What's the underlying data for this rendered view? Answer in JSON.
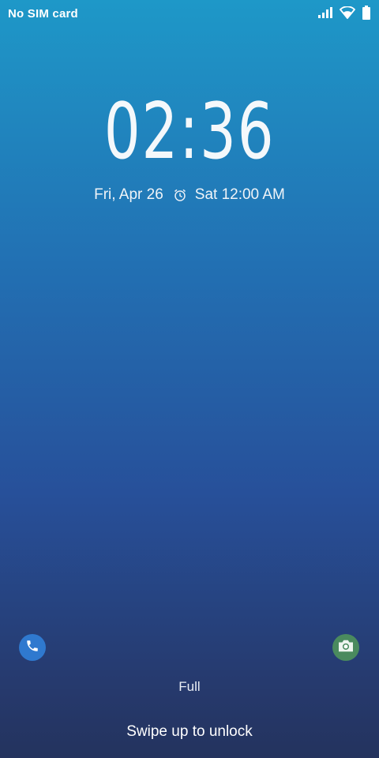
{
  "status_bar": {
    "carrier": "No SIM card",
    "icons": [
      "signal-icon",
      "wifi-icon",
      "battery-icon"
    ]
  },
  "lockscreen": {
    "time": "02:36",
    "date": "Fri, Apr 26",
    "alarm_icon": "alarm-icon",
    "next_alarm": "Sat 12:00 AM",
    "charge_status": "Full",
    "unlock_hint": "Swipe up to unlock"
  },
  "shortcuts": {
    "left": "phone-icon",
    "right": "camera-icon"
  },
  "colors": {
    "background_top": "#1e98c8",
    "background_bottom": "#24335e",
    "phone_button": "#2f79cf",
    "camera_button": "#4a8a5e"
  }
}
